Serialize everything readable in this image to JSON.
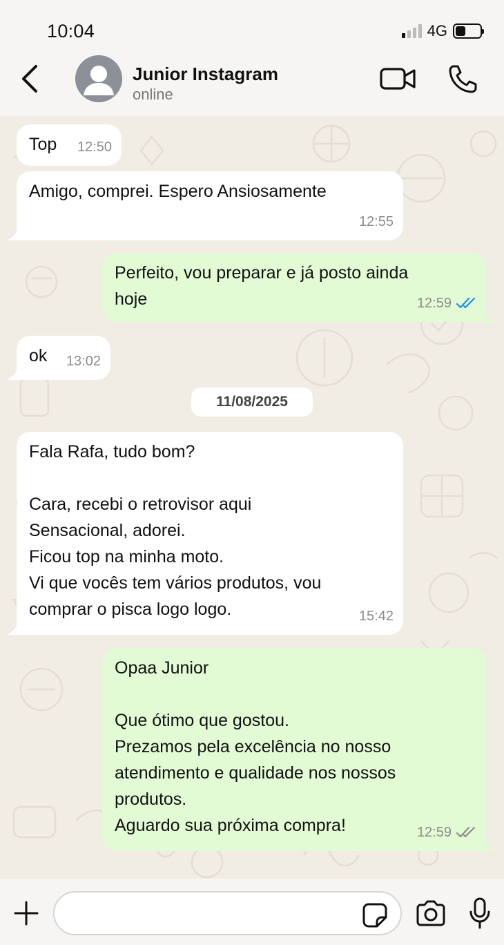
{
  "status_bar": {
    "time": "10:04",
    "network": "4G",
    "signal_bars_on": 1,
    "signal_bars_total": 4,
    "battery_level": 0.4
  },
  "header": {
    "contact_name": "Junior Instagram",
    "contact_status": "online"
  },
  "messages": [
    {
      "direction": "incoming",
      "text": "Top",
      "time": "12:50"
    },
    {
      "direction": "incoming",
      "text": "Amigo, comprei. Espero Ansiosamente",
      "time": "12:55"
    },
    {
      "direction": "outgoing",
      "text": "Perfeito, vou preparar e já posto ainda\nhoje",
      "time": "12:59",
      "status": "read"
    },
    {
      "direction": "incoming",
      "text": "ok",
      "time": "13:02"
    },
    {
      "direction": "incoming",
      "text": "Fala Rafa, tudo bom?\n\nCara, recebi o retrovisor aqui\nSensacional, adorei.\nFicou top na minha moto.\nVi que vocês tem vários produtos, vou\ncomprar o pisca logo logo.",
      "time": "15:42"
    },
    {
      "direction": "outgoing",
      "text": "Opaa Junior\n\nQue ótimo que gostou.\nPrezamos pela excelência no nosso\natendimento e qualidade nos nossos\nprodutos.\nAguardo sua próxima compra!",
      "time": "12:59",
      "status": "delivered"
    }
  ],
  "date_separator": "11/08/2025",
  "input": {
    "value": "",
    "placeholder": ""
  },
  "colors": {
    "incoming_bubble": "#ffffff",
    "outgoing_bubble": "#e2fbd5",
    "read_ticks": "#1d8cf0",
    "delivered_ticks": "#8b8b8b",
    "chat_background": "#f1ece4"
  },
  "icons": {
    "back": "chevron-left-icon",
    "avatar": "default-avatar-icon",
    "video": "video-camera-icon",
    "call": "phone-icon",
    "plus": "plus-icon",
    "sticker": "sticker-icon",
    "camera": "camera-icon",
    "mic": "microphone-icon"
  }
}
